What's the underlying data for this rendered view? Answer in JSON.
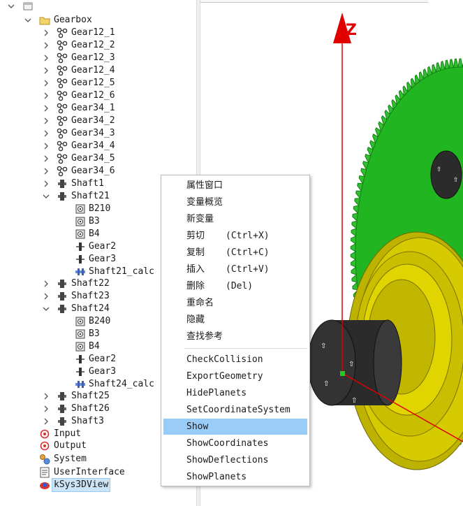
{
  "tree": {
    "items": [
      {
        "label": "",
        "level": 0,
        "chevron": "down",
        "icon": "window-icon"
      },
      {
        "label": "Gearbox",
        "level": 1,
        "chevron": "down",
        "icon": "folder-icon"
      },
      {
        "label": "Gear12_1",
        "level": 2,
        "chevron": "right",
        "icon": "gear-pair-icon"
      },
      {
        "label": "Gear12_2",
        "level": 2,
        "chevron": "right",
        "icon": "gear-pair-icon"
      },
      {
        "label": "Gear12_3",
        "level": 2,
        "chevron": "right",
        "icon": "gear-pair-icon"
      },
      {
        "label": "Gear12_4",
        "level": 2,
        "chevron": "right",
        "icon": "gear-pair-icon"
      },
      {
        "label": "Gear12_5",
        "level": 2,
        "chevron": "right",
        "icon": "gear-pair-icon"
      },
      {
        "label": "Gear12_6",
        "level": 2,
        "chevron": "right",
        "icon": "gear-pair-icon"
      },
      {
        "label": "Gear34_1",
        "level": 2,
        "chevron": "right",
        "icon": "gear-pair-icon"
      },
      {
        "label": "Gear34_2",
        "level": 2,
        "chevron": "right",
        "icon": "gear-pair-icon"
      },
      {
        "label": "Gear34_3",
        "level": 2,
        "chevron": "right",
        "icon": "gear-pair-icon"
      },
      {
        "label": "Gear34_4",
        "level": 2,
        "chevron": "right",
        "icon": "gear-pair-icon"
      },
      {
        "label": "Gear34_5",
        "level": 2,
        "chevron": "right",
        "icon": "gear-pair-icon"
      },
      {
        "label": "Gear34_6",
        "level": 2,
        "chevron": "right",
        "icon": "gear-pair-icon"
      },
      {
        "label": "Shaft1",
        "level": 2,
        "chevron": "right",
        "icon": "shaft-icon"
      },
      {
        "label": "Shaft21",
        "level": 2,
        "chevron": "down",
        "icon": "shaft-icon"
      },
      {
        "label": "B210",
        "level": 3,
        "chevron": "none",
        "icon": "bearing-icon"
      },
      {
        "label": "B3",
        "level": 3,
        "chevron": "none",
        "icon": "bearing-icon"
      },
      {
        "label": "B4",
        "level": 3,
        "chevron": "none",
        "icon": "bearing-icon"
      },
      {
        "label": "Gear2",
        "level": 3,
        "chevron": "none",
        "icon": "shaft-gear-icon"
      },
      {
        "label": "Gear3",
        "level": 3,
        "chevron": "none",
        "icon": "shaft-gear-icon"
      },
      {
        "label": "Shaft21_calc",
        "level": 3,
        "chevron": "none",
        "icon": "shaft-calc-icon"
      },
      {
        "label": "Shaft22",
        "level": 2,
        "chevron": "right",
        "icon": "shaft-icon"
      },
      {
        "label": "Shaft23",
        "level": 2,
        "chevron": "right",
        "icon": "shaft-icon"
      },
      {
        "label": "Shaft24",
        "level": 2,
        "chevron": "down",
        "icon": "shaft-icon"
      },
      {
        "label": "B240",
        "level": 3,
        "chevron": "none",
        "icon": "bearing-icon"
      },
      {
        "label": "B3",
        "level": 3,
        "chevron": "none",
        "icon": "bearing-icon"
      },
      {
        "label": "B4",
        "level": 3,
        "chevron": "none",
        "icon": "bearing-icon"
      },
      {
        "label": "Gear2",
        "level": 3,
        "chevron": "none",
        "icon": "shaft-gear-icon"
      },
      {
        "label": "Gear3",
        "level": 3,
        "chevron": "none",
        "icon": "shaft-gear-icon"
      },
      {
        "label": "Shaft24_calc",
        "level": 3,
        "chevron": "none",
        "icon": "shaft-calc-icon"
      },
      {
        "label": "Shaft25",
        "level": 2,
        "chevron": "right",
        "icon": "shaft-icon"
      },
      {
        "label": "Shaft26",
        "level": 2,
        "chevron": "right",
        "icon": "shaft-icon"
      },
      {
        "label": "Shaft3",
        "level": 2,
        "chevron": "right",
        "icon": "shaft-icon"
      },
      {
        "label": "Input",
        "level": 1,
        "chevron": "none",
        "icon": "input-icon"
      },
      {
        "label": "Output",
        "level": 1,
        "chevron": "none",
        "icon": "output-icon"
      },
      {
        "label": "System",
        "level": 1,
        "chevron": "none",
        "icon": "system-icon"
      },
      {
        "label": "UserInterface",
        "level": 1,
        "chevron": "none",
        "icon": "user-interface-icon"
      },
      {
        "label": "kSys3DView",
        "level": 1,
        "chevron": "none",
        "icon": "3d-view-icon",
        "selected": true
      }
    ]
  },
  "view3d": {
    "axis_label": "Z",
    "colors": {
      "axis": "#e00000",
      "gear_green": "#22bb22",
      "yellow": "#d4c800",
      "dark": "#2b2b2b",
      "origin_marker": "#22cc22"
    }
  },
  "context_menu": {
    "items": [
      {
        "label": "属性窗口",
        "shortcut": ""
      },
      {
        "label": "变量概览",
        "shortcut": ""
      },
      {
        "label": "新变量",
        "shortcut": ""
      },
      {
        "label": "剪切",
        "shortcut": "(Ctrl+X)"
      },
      {
        "label": "复制",
        "shortcut": "(Ctrl+C)"
      },
      {
        "label": "插入",
        "shortcut": "(Ctrl+V)"
      },
      {
        "label": "删除",
        "shortcut": "(Del)"
      },
      {
        "label": "重命名",
        "shortcut": ""
      },
      {
        "label": "隐藏",
        "shortcut": ""
      },
      {
        "label": "查找参考",
        "shortcut": ""
      },
      {
        "separator": true
      },
      {
        "label": "CheckCollision",
        "shortcut": ""
      },
      {
        "label": "ExportGeometry",
        "shortcut": ""
      },
      {
        "label": "HidePlanets",
        "shortcut": ""
      },
      {
        "label": "SetCoordinateSystem",
        "shortcut": ""
      },
      {
        "label": "Show",
        "shortcut": "",
        "highlighted": true
      },
      {
        "label": "ShowCoordinates",
        "shortcut": ""
      },
      {
        "label": "ShowDeflections",
        "shortcut": ""
      },
      {
        "label": "ShowPlanets",
        "shortcut": ""
      }
    ]
  }
}
